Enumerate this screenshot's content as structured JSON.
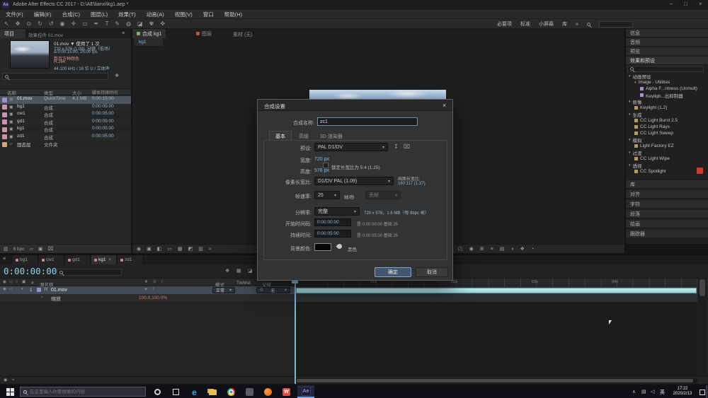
{
  "colors": {
    "accent_blue": "#7fb3da",
    "value_blue": "#8ab5d8",
    "warm_value": "#c87f68",
    "timeline_layer_bar": "#a9dde2",
    "selection_row": "#4d565f",
    "dialog_ok_button": "#44566e",
    "red_marker": "#cc3b2e"
  },
  "titlebar": {
    "app_badge": "Ae",
    "title": "Adobe After Effects CC 2017 - D:\\AE\\lianxi\\kg1.aep *",
    "minimize": "–",
    "restore": "□",
    "close": "×"
  },
  "menubar": {
    "items": [
      "文件(F)",
      "编辑(E)",
      "合成(C)",
      "图层(L)",
      "效果(T)",
      "动画(A)",
      "视图(V)",
      "窗口",
      "帮助(H)"
    ]
  },
  "toolbar": {
    "workspaces": [
      "必要项",
      "标准",
      "小屏幕",
      "库"
    ],
    "overflow": "»"
  },
  "project": {
    "tab_project": "项目",
    "tab_effect_controls": "效果控件 01.mov",
    "preview": {
      "title": "01.mov ▼ 使用了 1 次",
      "lines": [
        "720 x 576 (1.09), 分隔（低场）",
        "Δ 0:00:15:00, 25.00 fps",
        "数百万种颜色",
        "H.264",
        "44.100 kHz / 16 位 U / 立体声"
      ]
    },
    "columns": [
      "名称",
      "类型",
      "大小",
      "媒体持续时间"
    ],
    "rows": [
      {
        "name": "01.mov",
        "type": "QuickTime",
        "size": "4.1 MB",
        "duration": "0:00:15:00"
      },
      {
        "name": "bg1",
        "type": "合成",
        "size": "",
        "duration": "0:00:05:00"
      },
      {
        "name": "cw1",
        "type": "合成",
        "size": "",
        "duration": "0:00:05:00"
      },
      {
        "name": "gd1",
        "type": "合成",
        "size": "",
        "duration": "0:00:05:00"
      },
      {
        "name": "kg1",
        "type": "合成",
        "size": "",
        "duration": "0:00:05:00"
      },
      {
        "name": "zd1",
        "type": "合成",
        "size": "",
        "duration": "0:00:05:00"
      },
      {
        "name": "固态层",
        "type": "文件夹",
        "size": "",
        "duration": ""
      }
    ],
    "footer": {
      "bit_depth": "8 bpc"
    }
  },
  "comp": {
    "tab_composition": "合成 kg1",
    "tab_layer": "图层",
    "tab_footage": "素材 (无)",
    "viewer_tab": "kg1"
  },
  "dialog": {
    "title": "合成设置",
    "close": "×",
    "name_label": "合成名称:",
    "name_value": "zc1",
    "tabs": [
      "基本",
      "高级",
      "3D 渲染器"
    ],
    "preset_label": "预设:",
    "preset_value": "PAL D1/DV",
    "width_label": "宽度:",
    "width_value": "720 px",
    "height_label": "高度:",
    "height_value": "576 px",
    "lock_ar_label": "锁定长宽比为 5:4 (1.25)",
    "par_label": "像素长宽比:",
    "par_value": "D1/DV PAL (1.09)",
    "frame_ar_label": "画面长宽比:",
    "frame_ar_value": "160:117 (1.37)",
    "fps_label": "帧速率:",
    "fps_value": "25",
    "fps_unit": "帧/秒",
    "drop_frame_value": "丢帧",
    "res_label": "分辨率:",
    "res_value": "完整",
    "res_info": "720 x 576，1.6 MB（每 8bpc 帧）",
    "start_label": "开始时间码:",
    "start_value": "0:00:00:00",
    "start_info": "是 0:00:00:00 基础 25",
    "duration_label": "持续时间:",
    "duration_value": "0:00:05:00",
    "duration_info": "是 0:00:05:00 基础 25",
    "bg_label": "背景颜色:",
    "bg_color": "#000000",
    "bg_name": "黑色",
    "ok": "确定",
    "cancel": "取消"
  },
  "effects": {
    "tab_info": "信息",
    "tab_audio": "音频",
    "tab_preview": "预览",
    "header": "效果和预设",
    "tree": [
      {
        "label": "动画预设"
      },
      {
        "label": "Image - Utilities"
      },
      {
        "label": "Alpha F...ntness (Unmult)"
      },
      {
        "label": "Keyligh...出抑制器"
      },
      {
        "label": "抠像"
      },
      {
        "label": "Keylight (1.2)"
      },
      {
        "label": "生成"
      },
      {
        "label": "CC Light Burst 2.5"
      },
      {
        "label": "CC Light Rays"
      },
      {
        "label": "CC Light Sweep"
      },
      {
        "label": "模拟"
      },
      {
        "label": "Light Factory EZ"
      },
      {
        "label": "过渡"
      },
      {
        "label": "CC Light Wipe"
      },
      {
        "label": "透视"
      },
      {
        "label": "CC Spotlight"
      }
    ],
    "bottom_tabs": [
      "库",
      "对齐",
      "字符",
      "段落",
      "绘画",
      "跟踪器"
    ]
  },
  "timeline": {
    "tabs": [
      "bg1",
      "cw1",
      "gd1",
      "kg1",
      "zd1"
    ],
    "timecode": "0:00:00:00",
    "col_index": "#",
    "col_source": "源名称",
    "col_mode": "模式",
    "col_trkmat": "TrkMat",
    "col_parent": "父级",
    "layer_index": "1",
    "layer_name": "01.mov",
    "layer_mode": "正常",
    "layer_parent": "无",
    "prop_label": "缩放",
    "prop_value": "100.0,100.0%",
    "ruler": [
      "01s",
      "02s",
      "03s",
      "04s"
    ]
  },
  "taskbar": {
    "search_placeholder": "在这里输入你要搜索的内容",
    "lang": "英",
    "time": "17:22",
    "date": "2020/2/13"
  }
}
